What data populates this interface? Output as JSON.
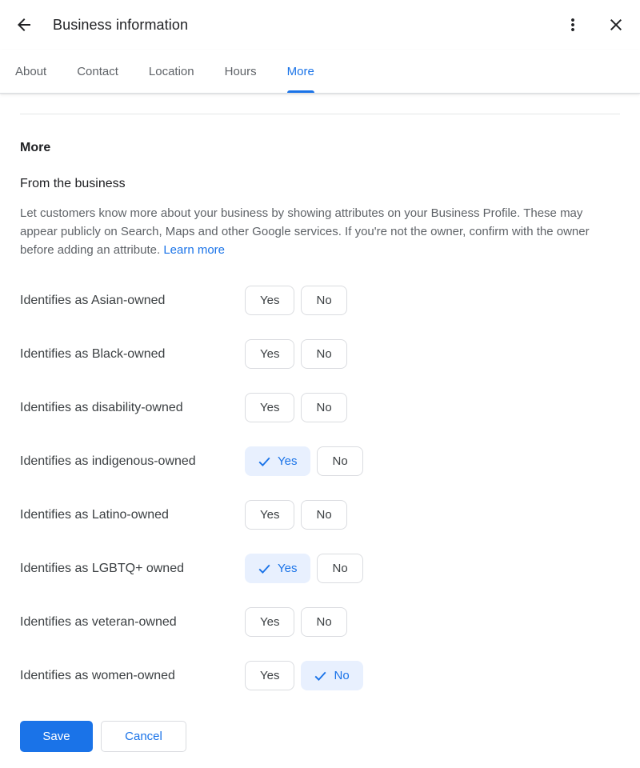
{
  "header": {
    "title": "Business information"
  },
  "tabs": [
    {
      "label": "About",
      "active": false
    },
    {
      "label": "Contact",
      "active": false
    },
    {
      "label": "Location",
      "active": false
    },
    {
      "label": "Hours",
      "active": false
    },
    {
      "label": "More",
      "active": true
    }
  ],
  "section": {
    "heading": "More",
    "subheading": "From the business",
    "description": "Let customers know more about your business by showing attributes on your Business Profile. These may appear publicly on Search, Maps and other Google services. If you're not the owner, confirm with the owner before adding an attribute.",
    "learn_more_label": "Learn more"
  },
  "attributes": {
    "yes_label": "Yes",
    "no_label": "No",
    "items": [
      {
        "label": "Identifies as Asian-owned",
        "selected": null
      },
      {
        "label": "Identifies as Black-owned",
        "selected": null
      },
      {
        "label": "Identifies as disability-owned",
        "selected": null
      },
      {
        "label": "Identifies as indigenous-owned",
        "selected": "yes"
      },
      {
        "label": "Identifies as Latino-owned",
        "selected": null
      },
      {
        "label": "Identifies as LGBTQ+ owned",
        "selected": "yes"
      },
      {
        "label": "Identifies as veteran-owned",
        "selected": null
      },
      {
        "label": "Identifies as women-owned",
        "selected": "no"
      }
    ]
  },
  "actions": {
    "save_label": "Save",
    "cancel_label": "Cancel"
  },
  "colors": {
    "accent": "#1a73e8",
    "selected_bg": "#e8f0fe",
    "border": "#dadce0",
    "text_primary": "#202124",
    "text_secondary": "#5f6368"
  }
}
